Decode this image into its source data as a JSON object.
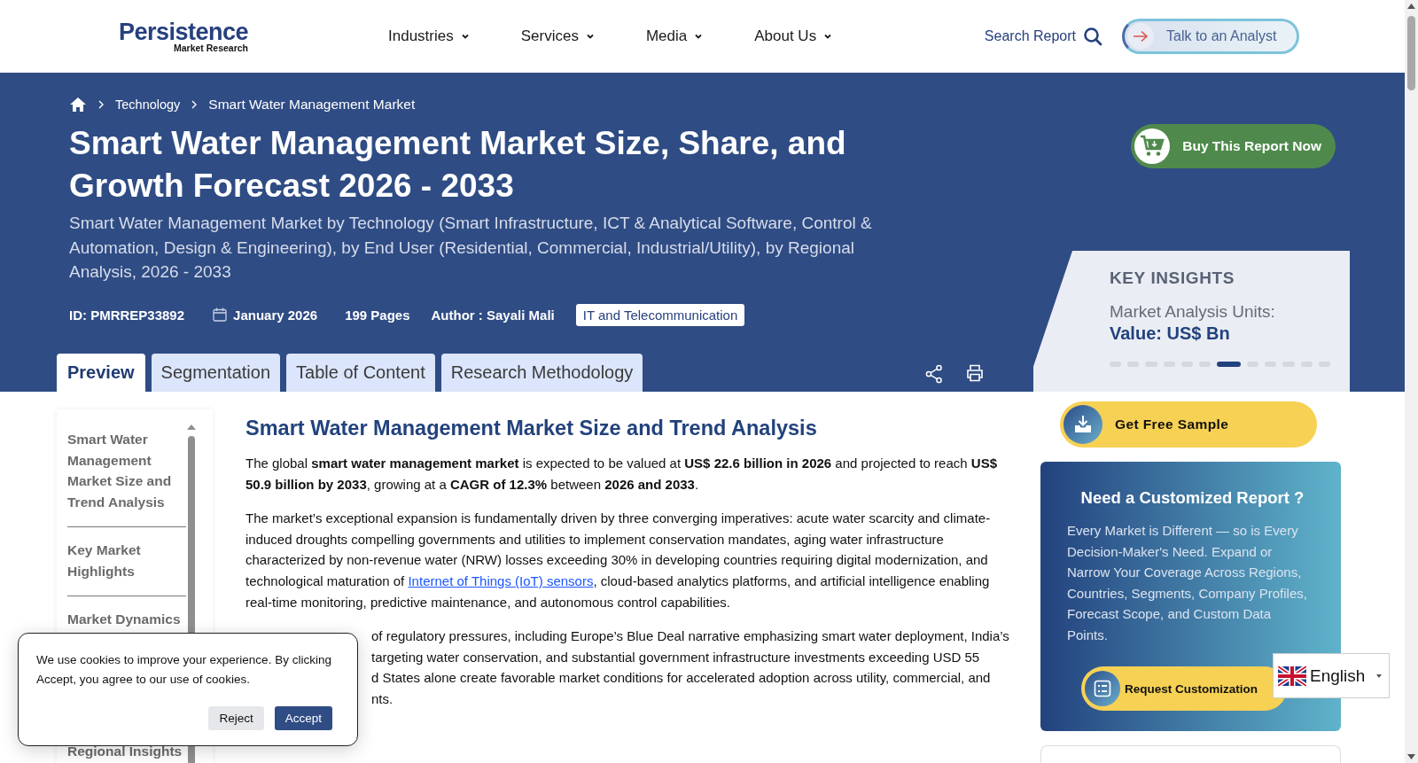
{
  "header": {
    "logo": {
      "name": "Persistence",
      "tagline": "Market Research"
    },
    "nav": [
      {
        "label": "Industries"
      },
      {
        "label": "Services"
      },
      {
        "label": "Media"
      },
      {
        "label": "About Us"
      }
    ],
    "search_label": "Search Report",
    "cta": "Talk to an Analyst"
  },
  "breadcrumb": [
    "Technology",
    "Smart Water Management Market"
  ],
  "title": "Smart Water Management Market Size, Share, and Growth Forecast 2026 - 2033",
  "subtitle": "Smart Water Management Market by Technology (Smart Infrastructure, ICT & Analytical Software, Control & Automation, Design & Engineering), by End User (Residential, Commercial, Industrial/Utility), by Regional Analysis, 2026 - 2033",
  "meta": {
    "id": "ID: PMRREP33892",
    "date": "January 2026",
    "pages": "199 Pages",
    "author": "Author : Sayali Mali",
    "category": "IT and Telecommunication"
  },
  "tabs": [
    {
      "label": "Preview",
      "selected": true
    },
    {
      "label": "Segmentation",
      "selected": false
    },
    {
      "label": "Table of Content",
      "selected": false
    },
    {
      "label": "Research Methodology",
      "selected": false
    }
  ],
  "buy_button": "Buy This Report Now",
  "key_insights": {
    "heading": "KEY INSIGHTS",
    "label": "Market Analysis Units:",
    "value": "Value: US$ Bn",
    "slides": [
      {
        "selected": false
      },
      {
        "selected": false
      },
      {
        "selected": false
      },
      {
        "selected": false
      },
      {
        "selected": false
      },
      {
        "selected": false
      },
      {
        "selected": true
      },
      {
        "selected": false
      },
      {
        "selected": false
      },
      {
        "selected": false
      },
      {
        "selected": false
      },
      {
        "selected": false
      }
    ]
  },
  "toc": [
    {
      "label": "Smart Water Management Market Size and Trend Analysis"
    },
    {
      "label": "Key Market Highlights"
    },
    {
      "label": "Market Dynamics"
    },
    {
      "label": "Regional Insights"
    }
  ],
  "article": {
    "heading": "Smart Water Management Market Size and Trend Analysis",
    "intro": "The global **smart water management market** is expected to be valued at **US$ 22.6 billion in 2026** and projected to reach **US$ 50.9 billion by 2033**, growing at a **CAGR of 12.3%** between **2026 and 2033**.",
    "drivers": {
      "before": "The market’s exceptional expansion is fundamentally driven by three converging imperatives: acute water scarcity and climate-induced droughts compelling governments and utilities to implement conservation mandates, aging water infrastructure characterized by non-revenue water (NRW) losses exceeding 30% in developing countries requiring digital modernization, and technological maturation of ",
      "link": "Internet of Things (IoT) sensors",
      "after": ", cloud-based analytics platforms, and artificial intelligence enabling real-time monitoring, predictive maintenance, and autonomous control capabilities."
    },
    "partial_lines": [
      "of regulatory pressures, including Europe’s Blue Deal narrative emphasizing smart water deployment, India’s",
      "targeting water conservation, and substantial government infrastructure investments exceeding USD 55",
      "d States alone create favorable market conditions for accelerated adoption across utility, commercial, and",
      "nts."
    ]
  },
  "sample_button": "Get Free Sample",
  "custom_card": {
    "heading": "Need a Customized Report ?",
    "body": "Every Market is Different — so is Every Decision-Maker's Need. Expand or Narrow Your Coverage Across Regions, Countries, Segments, Company Profiles, Forecast Scope, and Custom Data Points.",
    "button": "Request Customization"
  },
  "language": "English",
  "cookie": {
    "text": "We use cookies to improve your experience. By clicking Accept, you agree to our use of cookies.",
    "buttons": [
      {
        "label": "Reject",
        "kind": "secondary"
      },
      {
        "label": "Accept",
        "kind": "primary"
      }
    ]
  }
}
